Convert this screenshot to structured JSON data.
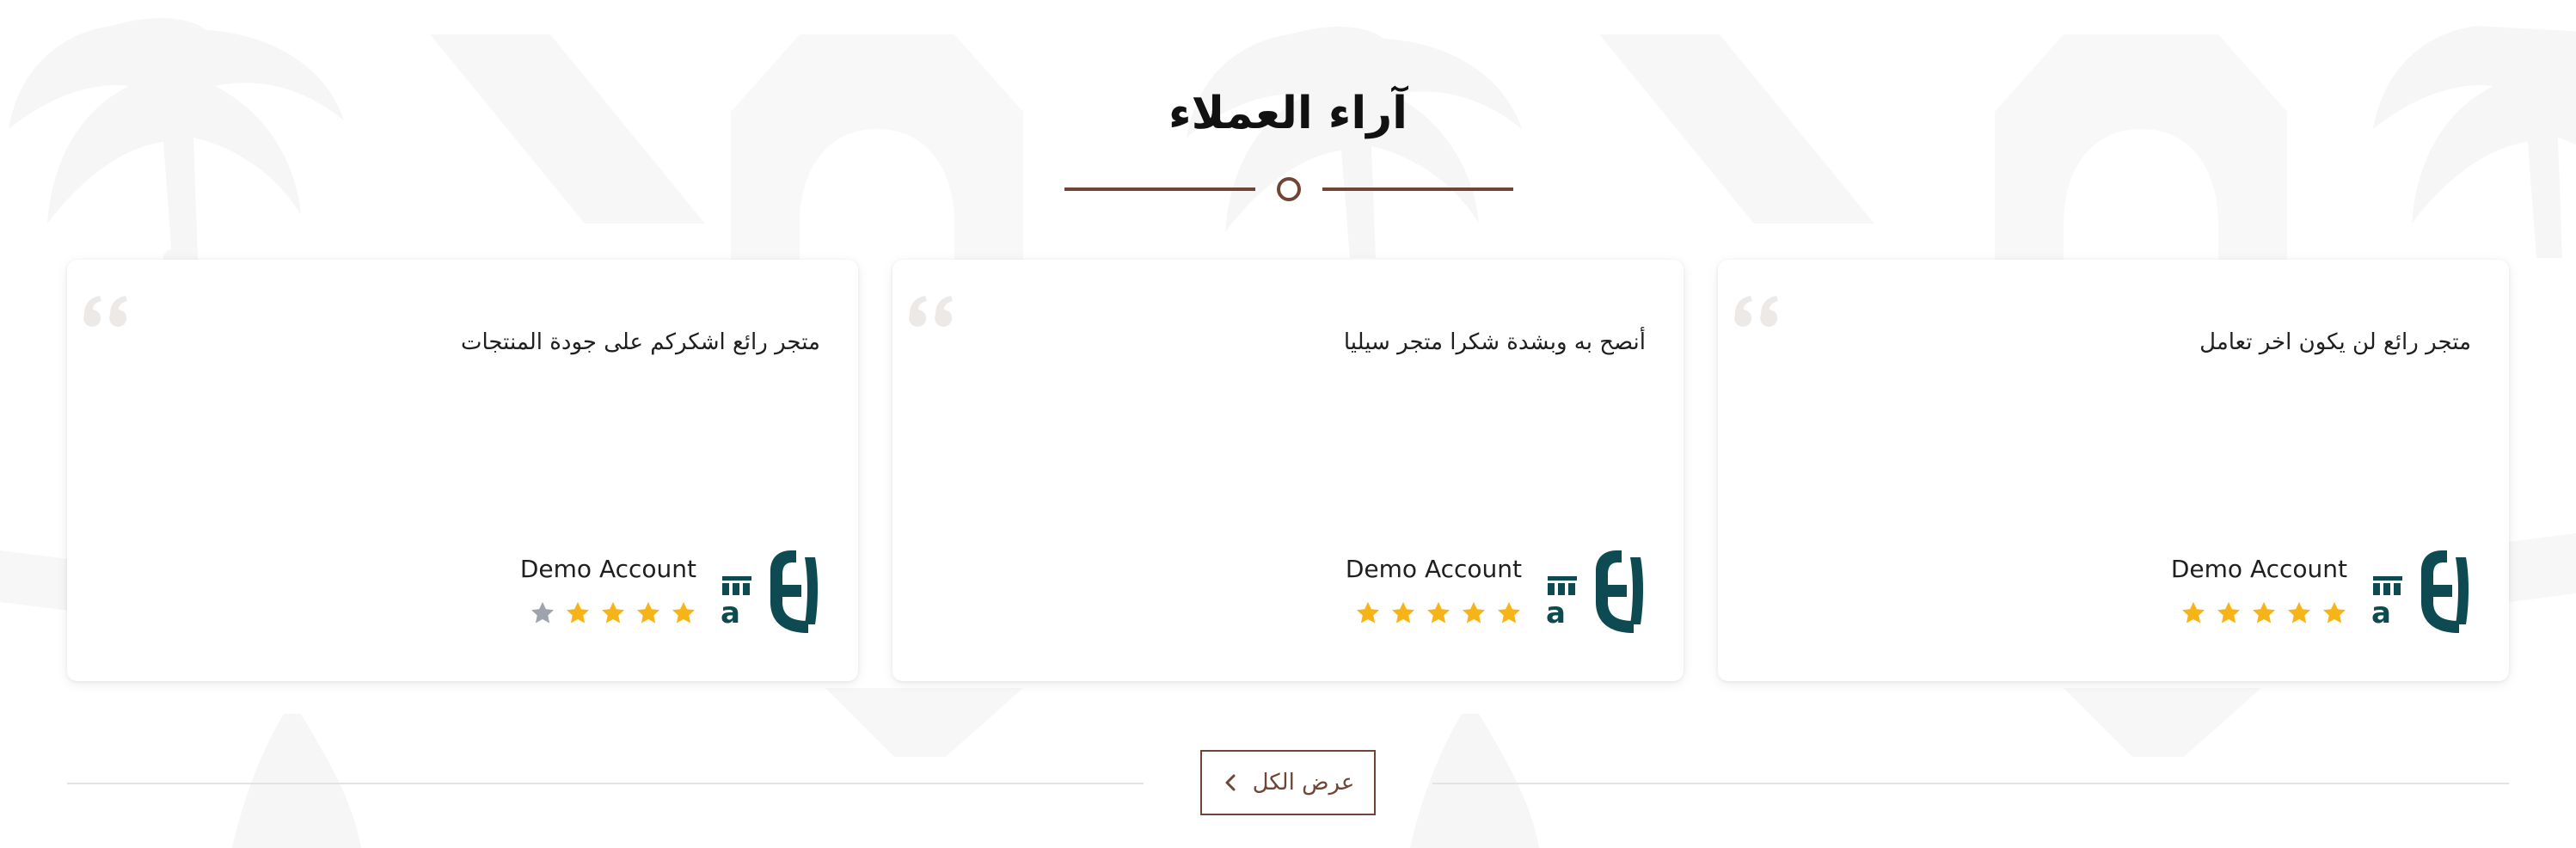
{
  "section": {
    "title": "آراء العملاء"
  },
  "colors": {
    "accent": "#6f4536",
    "star_filled": "#f7b418",
    "star_empty": "#9ea3ad",
    "logo": "#0d4a52",
    "quote_mark": "#ece9e6"
  },
  "icons": {
    "divider": "circle-divider-icon",
    "quote": "quote-icon",
    "avatar": "brand-logo-avatar",
    "star": "star-icon",
    "view_all": "chevron-left-icon"
  },
  "reviews": [
    {
      "text": "متجر رائع لن يكون اخر تعامل",
      "name": "Demo Account",
      "rating": 5
    },
    {
      "text": "أنصح به وبشدة شكرا متجر سيليا",
      "name": "Demo Account",
      "rating": 5
    },
    {
      "text": "متجر رائع اشكركم على جودة المنتجات",
      "name": "Demo Account",
      "rating": 4
    }
  ],
  "view_all": {
    "label": "عرض الكل"
  }
}
